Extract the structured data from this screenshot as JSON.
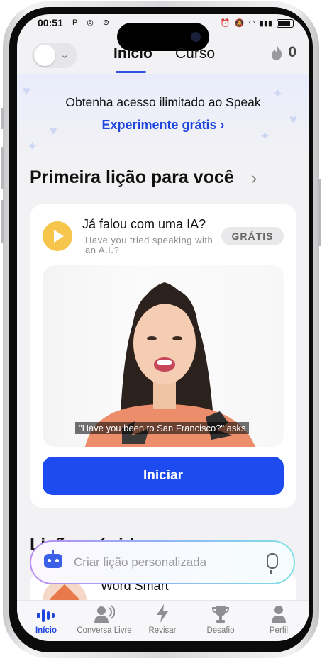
{
  "status": {
    "time": "00:51",
    "left_icons": "P ◎ ⊛"
  },
  "nav": {
    "tabs": [
      {
        "label": "Início"
      },
      {
        "label": "Curso"
      }
    ],
    "streak_count": "0"
  },
  "banner": {
    "title": "Obtenha acesso ilimitado ao Speak",
    "cta": "Experimente grátis"
  },
  "section": {
    "title": "Primeira lição para você"
  },
  "lesson": {
    "title": "Já falou com uma IA?",
    "subtitle": "Have you tried speaking with an A.I.?",
    "badge": "GRÁTIS",
    "caption": "\"Have you been to San Francisco?\" asks",
    "start_label": "Iniciar"
  },
  "next_section": {
    "title_partial": "Lições rápidas"
  },
  "next_card": {
    "title": "Word Smart"
  },
  "create": {
    "placeholder": "Criar lição personalizada"
  },
  "bottom_nav": [
    {
      "label": "Início",
      "icon": "voice-bars-icon"
    },
    {
      "label": "Conversa Livre",
      "icon": "speaking-person-icon"
    },
    {
      "label": "Revisar",
      "icon": "lightning-icon"
    },
    {
      "label": "Desafio",
      "icon": "trophy-icon"
    },
    {
      "label": "Perfil",
      "icon": "person-icon"
    }
  ],
  "colors": {
    "accent": "#1e4bef",
    "play": "#f6c54b",
    "background": "#f2f2f4"
  }
}
